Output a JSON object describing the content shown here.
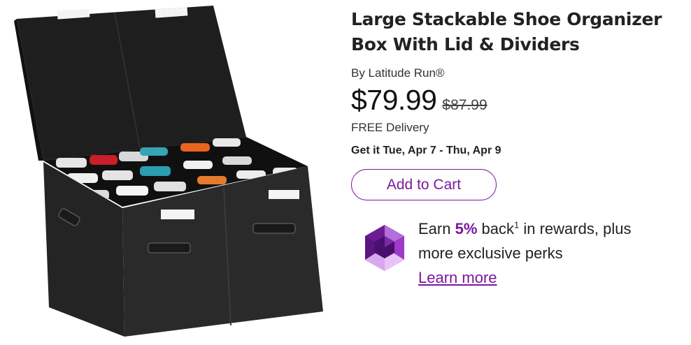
{
  "product": {
    "title_line1": "Large Stackable Shoe Organizer",
    "title_line2": "Box With Lid & Dividers",
    "brand": "By Latitude Run®",
    "price": "$79.99",
    "old_price": "$87.99",
    "delivery": "FREE Delivery",
    "eta": "Get it Tue, Apr 7 - Thu, Apr 9",
    "add_to_cart_label": "Add to Cart"
  },
  "rewards": {
    "earn_prefix": "Earn",
    "percent": "5%",
    "back": "back",
    "superscript": "1",
    "suffix_line1": "in rewards, plus",
    "line2": "more exclusive perks",
    "learn_more": "Learn more",
    "icon": "purple-gem-icon"
  },
  "colors": {
    "accent": "#7b189f",
    "text": "#222222",
    "box": "#1c1c1c"
  }
}
